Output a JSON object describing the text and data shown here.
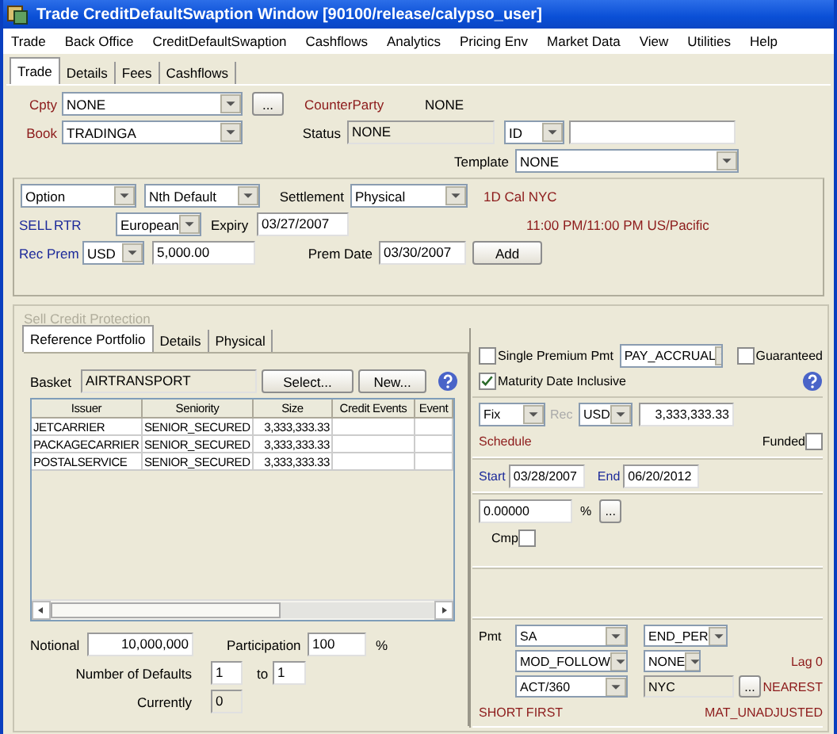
{
  "window": {
    "title": "Trade CreditDefaultSwaption Window  [90100/release/calypso_user]"
  },
  "menu": [
    "Trade",
    "Back Office",
    "CreditDefaultSwaption",
    "Cashflows",
    "Analytics",
    "Pricing Env",
    "Market Data",
    "View",
    "Utilities",
    "Help"
  ],
  "tabs": [
    {
      "label": "Trade",
      "selected": true
    },
    {
      "label": "Details",
      "selected": false
    },
    {
      "label": "Fees",
      "selected": false
    },
    {
      "label": "Cashflows",
      "selected": false
    }
  ],
  "trade_header": {
    "cpty": {
      "label": "Cpty",
      "value": "NONE"
    },
    "more_button": "...",
    "counterparty": {
      "label": "CounterParty",
      "value": "NONE"
    },
    "book": {
      "label": "Book",
      "value": "TRADINGA"
    },
    "status": {
      "label": "Status",
      "value": "NONE"
    },
    "id_type": "ID",
    "template": {
      "label": "Template",
      "value": "NONE"
    }
  },
  "option_terms": {
    "product_type": "Option",
    "basket_type": "Nth Default",
    "settlement": {
      "label": "Settlement",
      "value": "Physical"
    },
    "calendar": "1D Cal NYC",
    "direction": "SELL",
    "trade_code": "RTR",
    "exercise": "European",
    "expiry": {
      "label": "Expiry",
      "value": "03/27/2007"
    },
    "expiry_time": "11:00 PM/11:00 PM US/Pacific",
    "premium": {
      "label": "Rec Prem",
      "currency": "USD",
      "amount": "5,000.00"
    },
    "prem_date": {
      "label": "Prem Date",
      "value": "03/30/2007"
    },
    "add_button": "Add"
  },
  "protection": {
    "title": "Sell Credit Protection",
    "subtabs": [
      {
        "label": "Reference Portfolio",
        "selected": true
      },
      {
        "label": "Details",
        "selected": false
      },
      {
        "label": "Physical",
        "selected": false
      }
    ],
    "basket": {
      "label": "Basket",
      "value": "AIRTRANSPORT"
    },
    "select_button": "Select...",
    "new_button": "New...",
    "table": {
      "columns": [
        "Issuer",
        "Seniority",
        "Size",
        "Credit Events",
        "Event"
      ],
      "rows": [
        {
          "issuer": "JETCARRIER",
          "seniority": "SENIOR_SECURED",
          "size": "3,333,333.33"
        },
        {
          "issuer": "PACKAGECARRIER",
          "seniority": "SENIOR_SECURED",
          "size": "3,333,333.33"
        },
        {
          "issuer": "POSTALSERVICE",
          "seniority": "SENIOR_SECURED",
          "size": "3,333,333.33"
        }
      ]
    },
    "notional": {
      "label": "Notional",
      "value": "10,000,000"
    },
    "participation": {
      "label": "Participation",
      "value": "100",
      "unit": "%"
    },
    "defaults": {
      "label": "Number of Defaults",
      "from": "1",
      "to_label": "to",
      "to": "1"
    },
    "currently": {
      "label": "Currently",
      "value": "0"
    }
  },
  "premium_leg": {
    "single_premium": {
      "label": "Single Premium Pmt",
      "checked": false
    },
    "accrual": "PAY_ACCRUAL",
    "guaranteed": {
      "label": "Guaranteed",
      "checked": false
    },
    "maturity_inclusive": {
      "label": "Maturity Date Inclusive",
      "checked": true
    },
    "rate_type": "Fix",
    "rec_label": "Rec",
    "currency": "USD",
    "amount": "3,333,333.33",
    "schedule": "Schedule",
    "funded": {
      "label": "Funded",
      "checked": false
    },
    "start": {
      "label": "Start",
      "value": "03/28/2007"
    },
    "end": {
      "label": "End",
      "value": "06/20/2012"
    },
    "rate": "0.00000",
    "rate_unit": "%",
    "rate_button": "...",
    "compound": {
      "label": "Cmp",
      "checked": false
    },
    "pmt_label": "Pmt",
    "frequency": "SA",
    "period": "END_PER",
    "roll": "MOD_FOLLOW",
    "holiday": "NONE",
    "lag": "Lag 0",
    "day_count": "ACT/360",
    "calendar": "NYC",
    "calendar_button": "...",
    "rounding": "NEAREST",
    "stub": "SHORT FIRST",
    "maturity_adjust": "MAT_UNADJUSTED"
  }
}
